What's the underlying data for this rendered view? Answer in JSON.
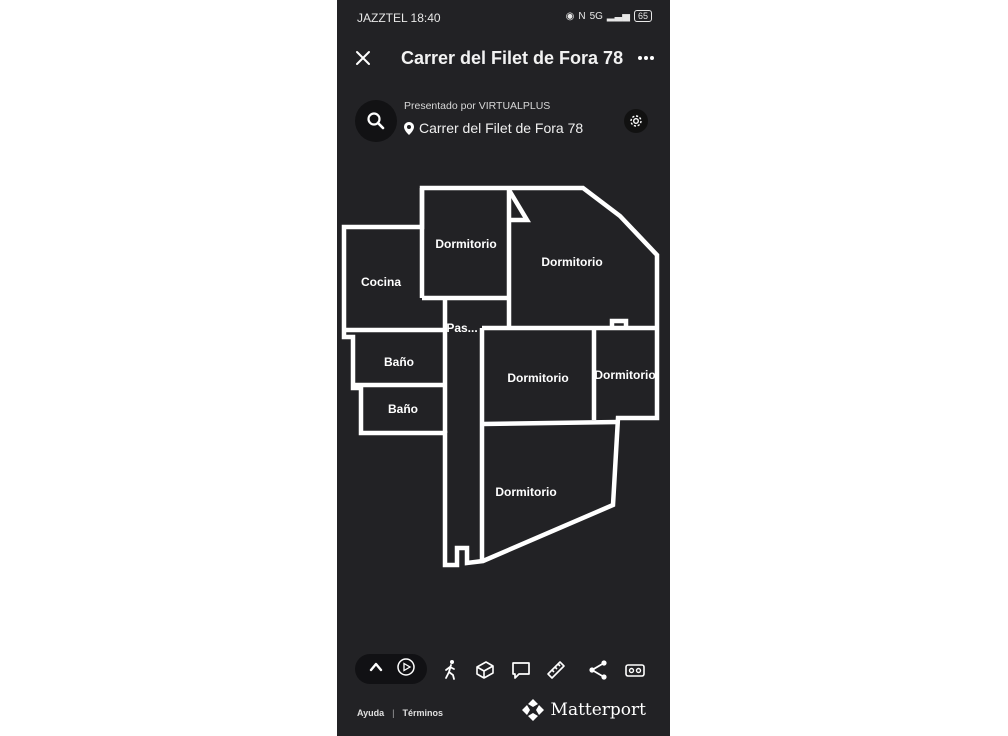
{
  "status_bar": {
    "carrier_time": "JAZZTEL 18:40",
    "network": "5G",
    "battery": "65"
  },
  "header": {
    "title": "Carrer del Filet de Fora 78",
    "close_icon": "close-icon",
    "more_icon": "more-icon"
  },
  "info": {
    "presented_by": "Presentado por VIRTUALPLUS",
    "address": "Carrer del Filet de Fora 78"
  },
  "rooms": [
    {
      "label": "Dormitorio"
    },
    {
      "label": "Dormitorio"
    },
    {
      "label": "Cocina"
    },
    {
      "label": "Pas..."
    },
    {
      "label": "Baño"
    },
    {
      "label": "Dormitorio"
    },
    {
      "label": "Dormitorio"
    },
    {
      "label": "Baño"
    },
    {
      "label": "Dormitorio"
    }
  ],
  "toolbar": {
    "icons": [
      "chevron-up-icon",
      "play-icon",
      "walk-icon",
      "dollhouse-icon",
      "comment-icon",
      "measure-icon",
      "share-icon",
      "vr-icon"
    ]
  },
  "footer": {
    "help": "Ayuda",
    "separator": "|",
    "terms": "Términos",
    "brand": "Matterport"
  },
  "colors": {
    "background": "#222225",
    "walls": "#ffffff"
  }
}
